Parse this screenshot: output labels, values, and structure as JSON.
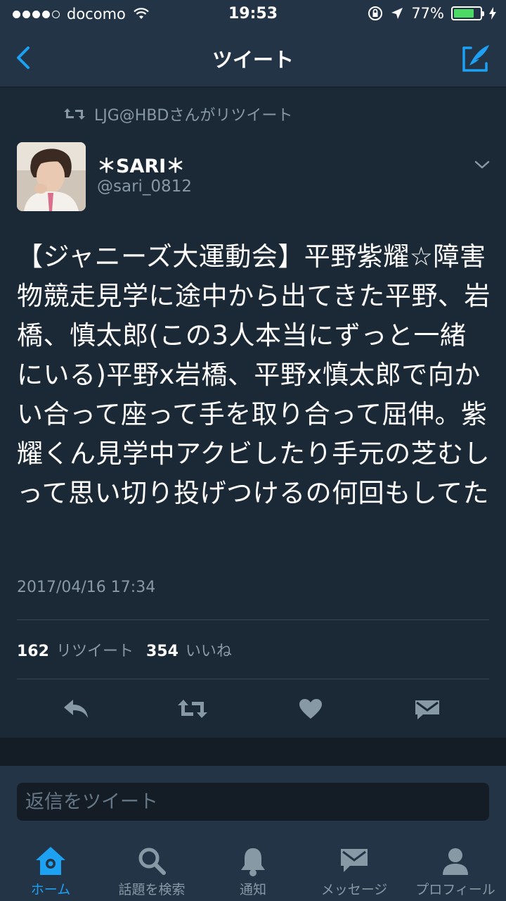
{
  "status_bar": {
    "carrier": "docomo",
    "time": "19:53",
    "battery": "77%",
    "battery_level": 0.77
  },
  "nav": {
    "title": "ツイート"
  },
  "tweet": {
    "retweet_context": "LJG@HBDさんがリツイート",
    "display_name": "＊SARI＊",
    "handle": "@sari_0812",
    "text": "【ジャニーズ大運動会】平野紫耀☆障害物競走見学に途中から出てきた平野、岩橋、慎太郎(この3人本当にずっと一緒にいる)平野x岩橋、平野x慎太郎で向かい合って座って手を取り合って屈伸。紫耀くん見学中アクビしたり手元の芝むしって思い切り投げつけるの何回もしてた",
    "timestamp": "2017/04/16 17:34",
    "retweet_count": "162",
    "retweet_label": "リツイート",
    "like_count": "354",
    "like_label": "いいね"
  },
  "reply": {
    "placeholder": "返信をツイート"
  },
  "tabs": [
    {
      "label": "ホーム",
      "icon": "home-icon",
      "active": true
    },
    {
      "label": "話題を検索",
      "icon": "search-icon",
      "active": false
    },
    {
      "label": "通知",
      "icon": "bell-icon",
      "active": false
    },
    {
      "label": "メッセージ",
      "icon": "envelope-icon",
      "active": false
    },
    {
      "label": "プロフィール",
      "icon": "person-icon",
      "active": false
    }
  ],
  "colors": {
    "background": "#1b2836",
    "bar": "#243447",
    "accent": "#1da1f2",
    "muted": "#8899a6"
  }
}
